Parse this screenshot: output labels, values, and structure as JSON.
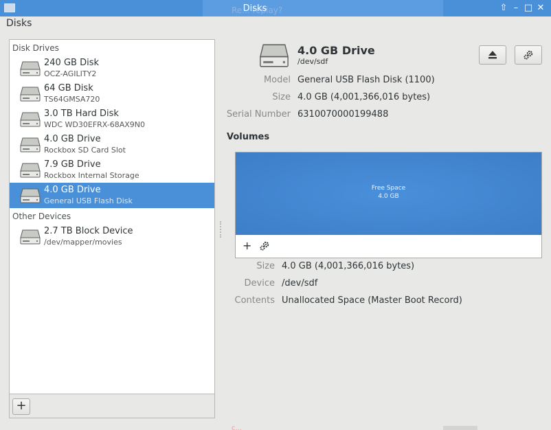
{
  "window": {
    "title": "Disks",
    "bleed_text": "Re... replay?",
    "bleed_text_bottom": "c..."
  },
  "app": {
    "title": "Disks"
  },
  "sidebar": {
    "drives_header": "Disk Drives",
    "drives": [
      {
        "name": "240 GB Disk",
        "sub": "OCZ-AGILITY2",
        "icon": "ssd-icon"
      },
      {
        "name": "64 GB Disk",
        "sub": "TS64GMSA720",
        "icon": "ssd-icon"
      },
      {
        "name": "3.0 TB Hard Disk",
        "sub": "WDC WD30EFRX-68AX9N0",
        "icon": "hard-disk-icon"
      },
      {
        "name": "4.0 GB Drive",
        "sub": "Rockbox SD Card Slot",
        "icon": "drive-icon"
      },
      {
        "name": "7.9 GB Drive",
        "sub": "Rockbox Internal Storage",
        "icon": "drive-icon"
      },
      {
        "name": "4.0 GB Drive",
        "sub": "General USB Flash Disk",
        "icon": "drive-icon",
        "selected": true
      }
    ],
    "other_header": "Other Devices",
    "other": [
      {
        "name": "2.7 TB Block Device",
        "sub": "/dev/mapper/movies",
        "icon": "block-device-icon"
      }
    ],
    "add_label": "+"
  },
  "main": {
    "drive_title": "4.0 GB Drive",
    "drive_device": "/dev/sdf",
    "details": {
      "model_label": "Model",
      "model_value": "General USB Flash Disk (1100)",
      "size_label": "Size",
      "size_value": "4.0 GB (4,001,366,016 bytes)",
      "serial_label": "Serial Number",
      "serial_value": "6310070000199488"
    },
    "volumes_title": "Volumes",
    "volume": {
      "name": "Free Space",
      "size": "4.0 GB"
    },
    "volume_toolbar": {
      "add_label": "+"
    },
    "volume_details": {
      "size_label": "Size",
      "size_value": "4.0 GB (4,001,366,016 bytes)",
      "device_label": "Device",
      "device_value": "/dev/sdf",
      "contents_label": "Contents",
      "contents_value": "Unallocated Space (Master Boot Record)"
    }
  },
  "colors": {
    "titlebar": "#4a90d9",
    "selection": "#4a90d9",
    "volume_free": "#3d7ec8"
  }
}
